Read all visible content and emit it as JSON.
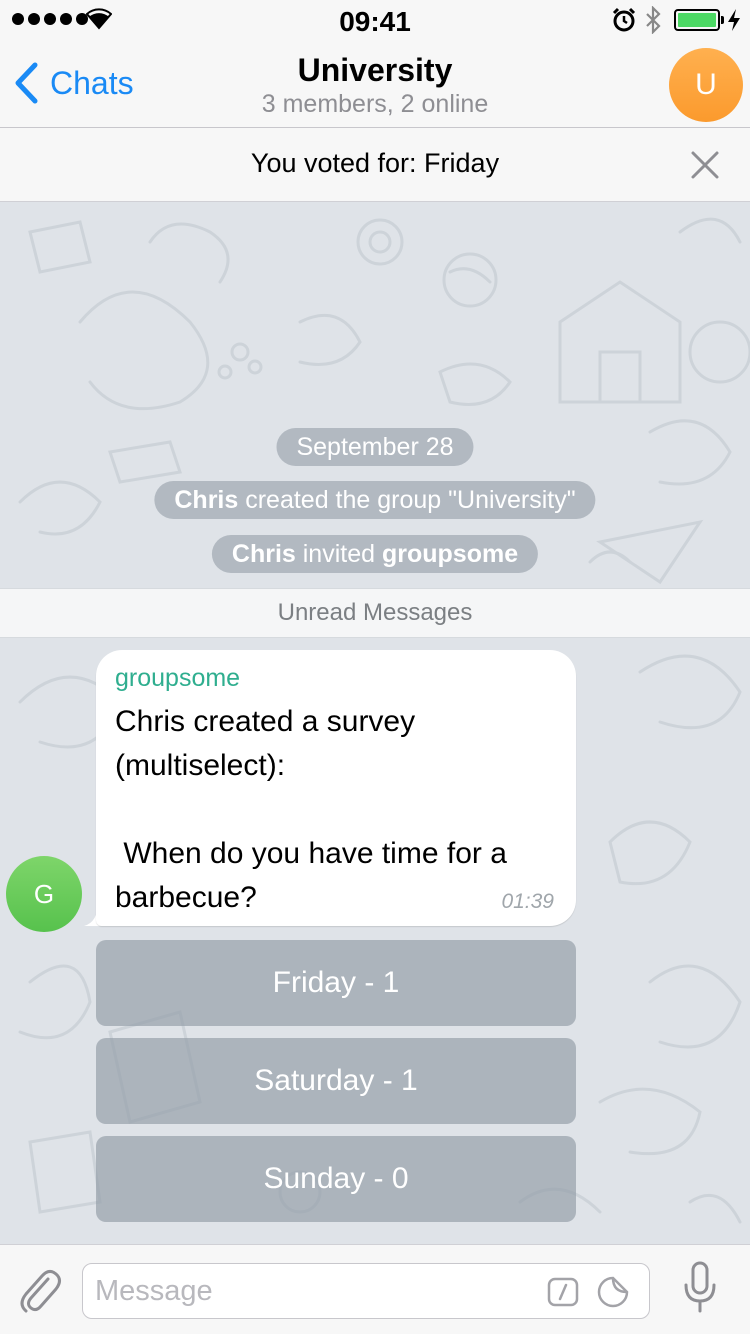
{
  "status_bar": {
    "time": "09:41",
    "icons": [
      "signal-dots-icon",
      "wifi-icon",
      "alarm-icon",
      "bluetooth-icon",
      "battery-icon",
      "charging-icon"
    ]
  },
  "nav": {
    "back_label": "Chats",
    "title": "University",
    "subtitle": "3 members, 2 online",
    "avatar_initial": "U",
    "avatar_color": "#fb9a2d"
  },
  "vote_banner": {
    "text": "You voted for: Friday"
  },
  "service_messages": {
    "date": "September 28",
    "created": {
      "actor": "Chris",
      "rest": " created the group \"University\""
    },
    "invited": {
      "actor": "Chris",
      "middle": " invited ",
      "target": "groupsome"
    }
  },
  "unread_label": "Unread Messages",
  "message": {
    "sender": "groupsome",
    "sender_color": "#2fae8f",
    "text": "Chris created a survey (multiselect):\n\n When do you have time for a barbecue?",
    "time": "01:39",
    "avatar_initial": "G",
    "avatar_color": "#57c24d"
  },
  "poll_options": [
    {
      "label": "Friday - 1"
    },
    {
      "label": "Saturday - 1"
    },
    {
      "label": "Sunday - 0"
    }
  ],
  "input": {
    "placeholder": "Message"
  },
  "colors": {
    "accent": "#1a8af5",
    "wallpaper": "#dfe3e8"
  }
}
